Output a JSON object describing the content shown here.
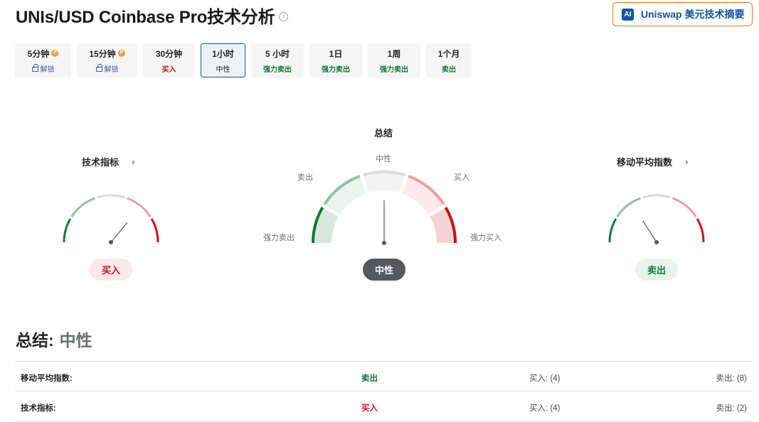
{
  "page": {
    "title": "UNIs/USD Coinbase Pro技术分析",
    "ai_button": {
      "badge": "AI",
      "label": "Uniswap 美元技术摘要"
    }
  },
  "tabs": [
    {
      "label": "5分钟",
      "sub": "解锁",
      "pro": true,
      "locked": true,
      "active": false,
      "tone": "unlock"
    },
    {
      "label": "15分钟",
      "sub": "解锁",
      "pro": true,
      "locked": true,
      "active": false,
      "tone": "unlock"
    },
    {
      "label": "30分钟",
      "sub": "买入",
      "pro": false,
      "locked": false,
      "active": false,
      "tone": "buy"
    },
    {
      "label": "1小时",
      "sub": "中性",
      "pro": false,
      "locked": false,
      "active": true,
      "tone": "neutral"
    },
    {
      "label": "5 小时",
      "sub": "强力卖出",
      "pro": false,
      "locked": false,
      "active": false,
      "tone": "sell"
    },
    {
      "label": "1日",
      "sub": "强力卖出",
      "pro": false,
      "locked": false,
      "active": false,
      "tone": "sell"
    },
    {
      "label": "1周",
      "sub": "强力卖出",
      "pro": false,
      "locked": false,
      "active": false,
      "tone": "sell"
    },
    {
      "label": "1个月",
      "sub": "卖出",
      "pro": false,
      "locked": false,
      "active": false,
      "tone": "sell"
    }
  ],
  "gauges": {
    "technical": {
      "title": "技术指标",
      "status": "买入",
      "needle_value": 0.72,
      "tone": "buy"
    },
    "summary": {
      "title": "总结",
      "status": "中性",
      "needle_value": 0.5,
      "tone": "neutral",
      "labels": {
        "neutral": "中性",
        "sell": "卖出",
        "buy": "买入",
        "strong_sell": "强力卖出",
        "strong_buy": "强力买入"
      }
    },
    "moving_avg": {
      "title": "移动平均指数",
      "status": "卖出",
      "needle_value": 0.32,
      "tone": "sell"
    }
  },
  "summary": {
    "label": "总结:",
    "value": "中性"
  },
  "table": [
    {
      "name": "移动平均指数:",
      "signal": "卖出",
      "tone": "sell",
      "buy": "买入: (4)",
      "sell": "卖出: (8)"
    },
    {
      "name": "技术指标:",
      "signal": "买入",
      "tone": "buy",
      "buy": "买入: (4)",
      "sell": "卖出: (2)"
    }
  ],
  "colors": {
    "strong_sell": "#0f7a35",
    "sell": "#8fc3a0",
    "neutral": "#dcdcdc",
    "buy": "#ee9f9c",
    "strong_buy": "#c8121a",
    "brand": "#1256a0",
    "accent": "#e07b28"
  }
}
